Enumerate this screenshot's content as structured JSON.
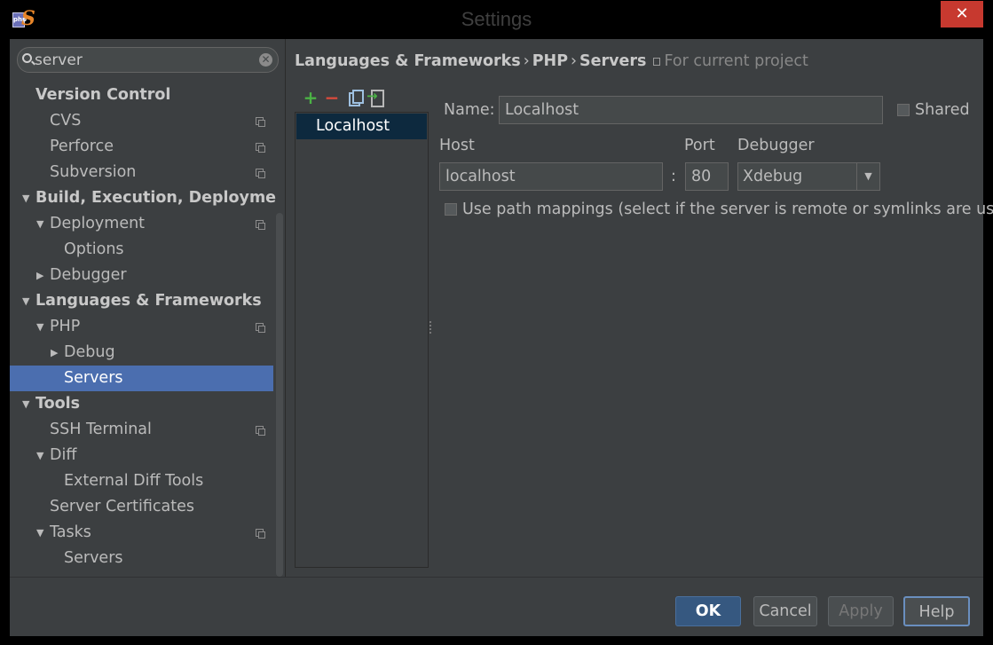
{
  "window": {
    "title": "Settings",
    "close_glyph": "✕"
  },
  "search": {
    "value": "server",
    "clear_glyph": "✕"
  },
  "tree": [
    {
      "label": "Version Control",
      "level": 0,
      "bold": true,
      "arrow": "",
      "project_icon": false
    },
    {
      "label": "CVS",
      "level": 1,
      "bold": false,
      "arrow": "",
      "project_icon": true
    },
    {
      "label": "Perforce",
      "level": 1,
      "bold": false,
      "arrow": "",
      "project_icon": true
    },
    {
      "label": "Subversion",
      "level": 1,
      "bold": false,
      "arrow": "",
      "project_icon": true
    },
    {
      "label": "Build, Execution, Deployment",
      "level": 0,
      "bold": true,
      "arrow": "▼",
      "project_icon": false
    },
    {
      "label": "Deployment",
      "level": 1,
      "bold": false,
      "arrow": "▼",
      "project_icon": true
    },
    {
      "label": "Options",
      "level": 2,
      "bold": false,
      "arrow": "",
      "project_icon": false
    },
    {
      "label": "Debugger",
      "level": 1,
      "bold": false,
      "arrow": "▶",
      "project_icon": false
    },
    {
      "label": "Languages & Frameworks",
      "level": 0,
      "bold": true,
      "arrow": "▼",
      "project_icon": false
    },
    {
      "label": "PHP",
      "level": 1,
      "bold": false,
      "arrow": "▼",
      "project_icon": true
    },
    {
      "label": "Debug",
      "level": 2,
      "bold": false,
      "arrow": "▶",
      "project_icon": false
    },
    {
      "label": "Servers",
      "level": 2,
      "bold": false,
      "arrow": "",
      "project_icon": false,
      "selected": true
    },
    {
      "label": "Tools",
      "level": 0,
      "bold": true,
      "arrow": "▼",
      "project_icon": false
    },
    {
      "label": "SSH Terminal",
      "level": 1,
      "bold": false,
      "arrow": "",
      "project_icon": true
    },
    {
      "label": "Diff",
      "level": 1,
      "bold": false,
      "arrow": "▼",
      "project_icon": false
    },
    {
      "label": "External Diff Tools",
      "level": 2,
      "bold": false,
      "arrow": "",
      "project_icon": false
    },
    {
      "label": "Server Certificates",
      "level": 1,
      "bold": false,
      "arrow": "",
      "project_icon": false
    },
    {
      "label": "Tasks",
      "level": 1,
      "bold": false,
      "arrow": "▼",
      "project_icon": true
    },
    {
      "label": "Servers",
      "level": 2,
      "bold": false,
      "arrow": "",
      "project_icon": false
    }
  ],
  "breadcrumb": {
    "parts": [
      "Languages & Frameworks",
      "PHP",
      "Servers"
    ],
    "separator": "›",
    "scope": "For current project"
  },
  "toolbar": {
    "add": "+",
    "remove": "−"
  },
  "servers": [
    "Localhost"
  ],
  "form": {
    "name_label": "Name:",
    "name_value": "Localhost",
    "shared_label": "Shared",
    "host_label": "Host",
    "host_value": "localhost",
    "port_label": "Port",
    "port_separator": ":",
    "port_value": "80",
    "debugger_label": "Debugger",
    "debugger_value": "Xdebug",
    "debugger_arrow": "▼",
    "path_mappings_label": "Use path mappings (select if the server is remote or symlinks are used)"
  },
  "buttons": {
    "ok": "OK",
    "cancel": "Cancel",
    "apply": "Apply",
    "help": "Help"
  },
  "colors": {
    "selection": "#4b6eaf",
    "panel": "#3c3f41",
    "ok_button": "#365880",
    "close": "#c7392f"
  }
}
